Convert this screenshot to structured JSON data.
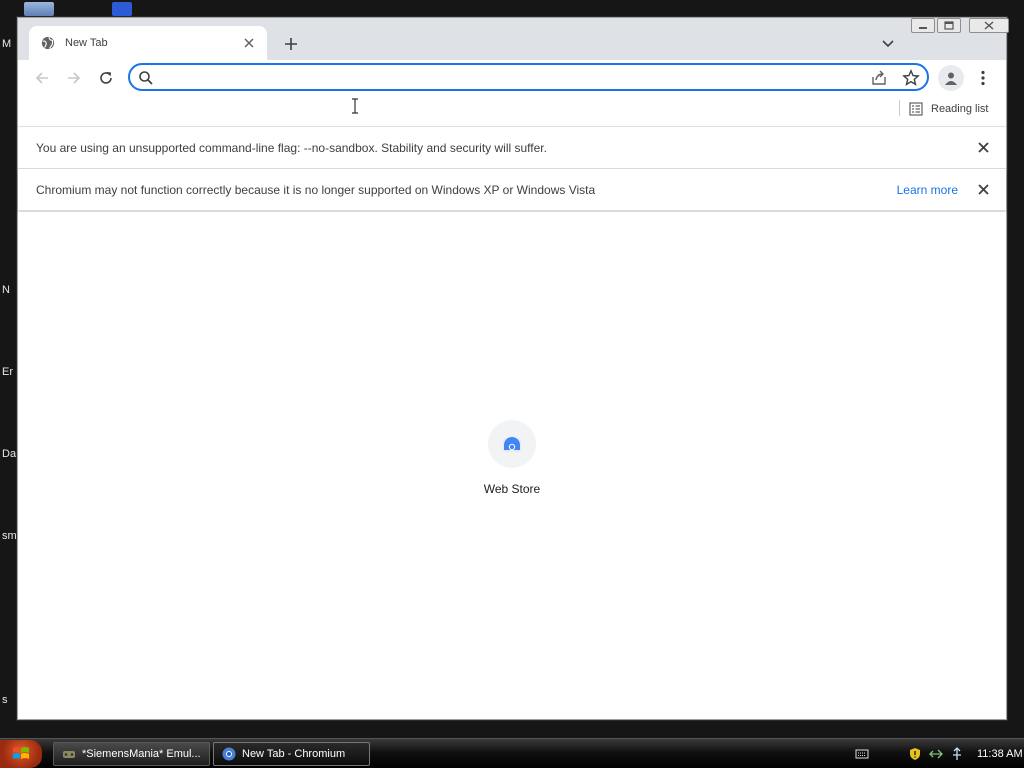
{
  "desktop": {
    "labels": [
      "M",
      "N",
      "Er",
      "Da",
      "sm",
      "s"
    ]
  },
  "window": {
    "tab": {
      "title": "New Tab",
      "icon": "globe-icon"
    },
    "controls": {
      "minimize": "minimize-icon",
      "maximize": "maximize-icon",
      "close": "close-icon"
    }
  },
  "toolbar": {
    "omnibox": {
      "value": "",
      "placeholder": ""
    }
  },
  "bookmarks_bar": {
    "reading_list_label": "Reading list"
  },
  "infobars": [
    {
      "text": "You are using an unsupported command-line flag: --no-sandbox. Stability and security will suffer.",
      "link": ""
    },
    {
      "text": "Chromium may not function correctly because it is no longer supported on Windows XP or Windows Vista",
      "link": "Learn more"
    }
  ],
  "new_tab_page": {
    "shortcuts": [
      {
        "label": "Web Store",
        "icon": "web-store-icon"
      }
    ]
  },
  "taskbar": {
    "items": [
      {
        "label": "*SiemensMania* Emul...",
        "icon": "emulator-icon",
        "active": false
      },
      {
        "label": "New Tab - Chromium",
        "icon": "chromium-icon",
        "active": true
      }
    ],
    "clock": "11:38 AM"
  },
  "colors": {
    "accent": "#1a73e8",
    "titlebar": "#dee1e6",
    "desktop": "#161616"
  }
}
